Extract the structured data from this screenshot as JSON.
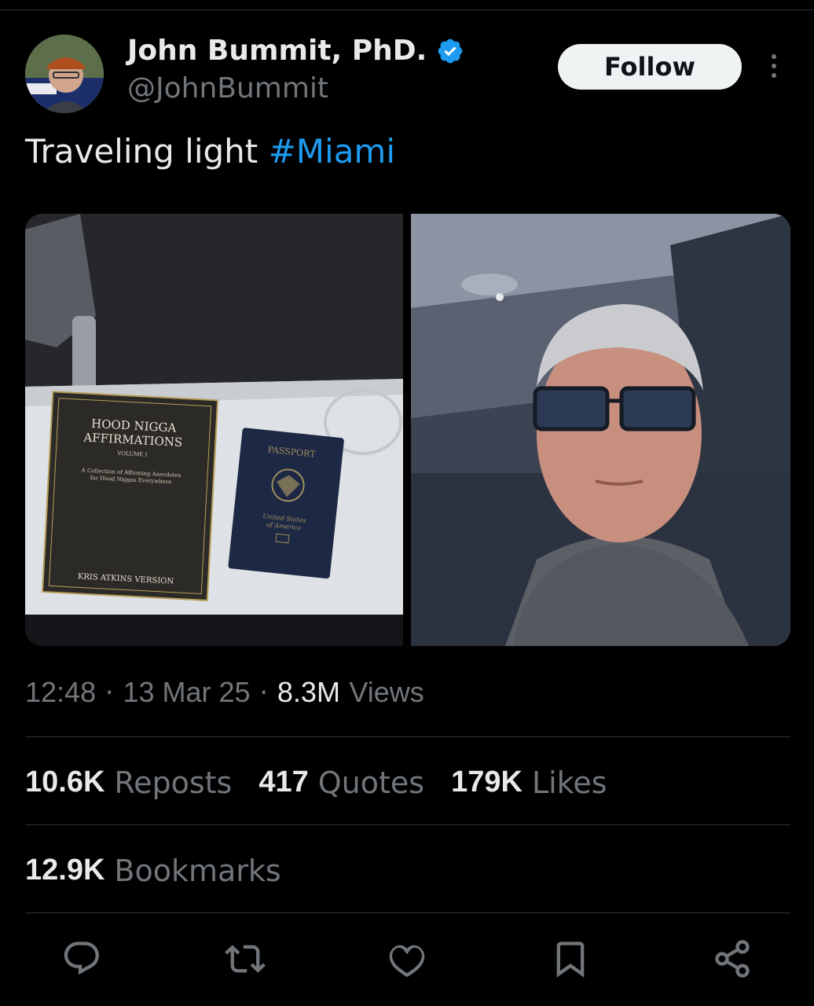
{
  "author": {
    "display_name": "John Bummit, PhD.",
    "handle": "@JohnBummit",
    "verified": true
  },
  "follow_label": "Follow",
  "tweet": {
    "text_prefix": "Traveling light ",
    "hashtag": "#Miami"
  },
  "media": {
    "left_photo": {
      "book_title_line1": "HOOD NIGGA",
      "book_title_line2": "AFFIRMATIONS",
      "book_volume": "VOLUME I",
      "book_subtitle_line1": "A Collection of Affirming Anecdotes",
      "book_subtitle_line2": "for Hood Niggas Everywhere",
      "book_author": "KRIS ATKINS VERSION",
      "passport_title": "PASSPORT",
      "passport_country_line1": "United States",
      "passport_country_line2": "of America"
    }
  },
  "meta": {
    "time": "12:48",
    "date": "13 Mar 25",
    "views_count": "8.3M",
    "views_label": "Views",
    "separator": "·"
  },
  "stats": {
    "reposts": {
      "value": "10.6K",
      "label": "Reposts"
    },
    "quotes": {
      "value": "417",
      "label": "Quotes"
    },
    "likes": {
      "value": "179K",
      "label": "Likes"
    },
    "bookmarks": {
      "value": "12.9K",
      "label": "Bookmarks"
    }
  },
  "colors": {
    "background": "#000000",
    "text": "#e7e9ea",
    "muted": "#71767b",
    "accent": "#1d9bf0",
    "divider": "#2f3336"
  },
  "actions": [
    "reply-icon",
    "repost-icon",
    "like-icon",
    "bookmark-icon",
    "share-icon"
  ]
}
